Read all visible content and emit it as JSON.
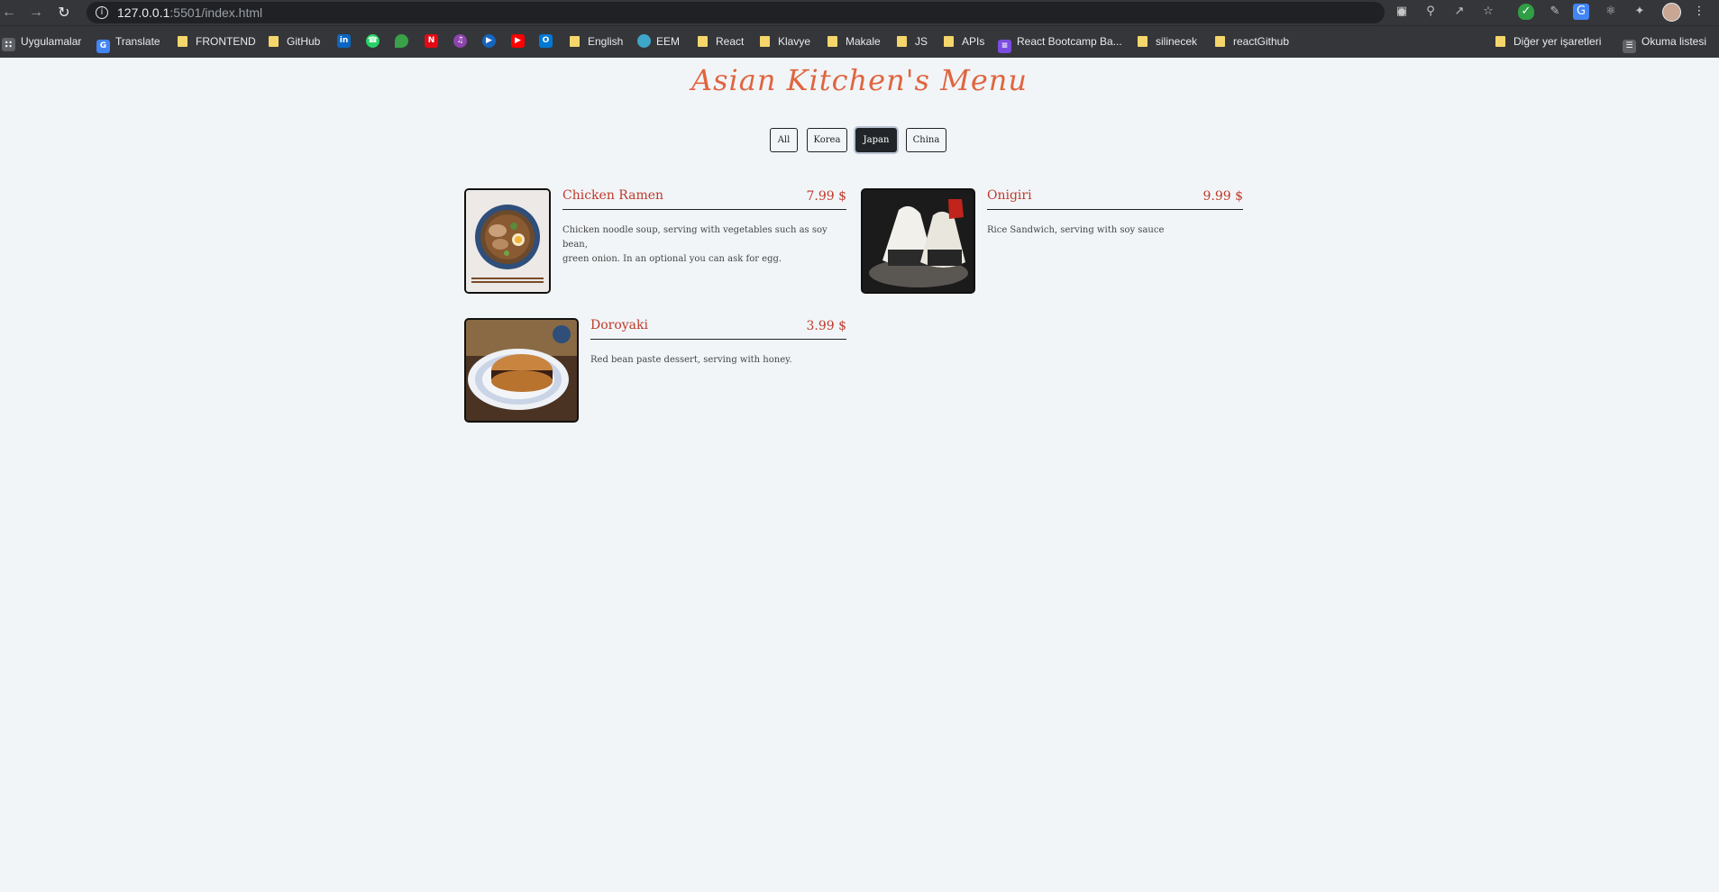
{
  "browser": {
    "url_host": "127.0.0.1",
    "url_path": ":5501/index.html",
    "bookmarks": [
      "Uygulamalar",
      "Translate",
      "FRONTEND",
      "GitHub",
      "English",
      "EEM",
      "React",
      "Klavye",
      "Makale",
      "JS",
      "APIs",
      "React Bootcamp Ba...",
      "silinecek",
      "reactGithub"
    ],
    "other_bookmarks": "Diğer yer işaretleri",
    "reading_list": "Okuma listesi"
  },
  "page": {
    "title": "Asian Kitchen's Menu",
    "filters": [
      "All",
      "Korea",
      "Japan",
      "China"
    ],
    "active_filter": "Japan",
    "items": [
      {
        "name": "Chicken Ramen",
        "price": "7.99 $",
        "desc_line1": "Chicken noodle soup, serving with vegetables such as soy bean,",
        "desc_line2": "green onion. In an optional you can ask for egg.",
        "image": "chicken-ramen-photo"
      },
      {
        "name": "Onigiri",
        "price": "9.99 $",
        "desc_line1": "Rice Sandwich, serving with soy sauce",
        "image": "onigiri-photo"
      },
      {
        "name": "Doroyaki",
        "price": "3.99 $",
        "desc_line1": "Red bean paste dessert, serving with honey.",
        "image": "doroyaki-photo"
      }
    ]
  },
  "colors": {
    "accent": "#e0653f",
    "item_text": "#c0392b",
    "background": "#f1f5f8",
    "active_filter_bg": "#212529"
  }
}
